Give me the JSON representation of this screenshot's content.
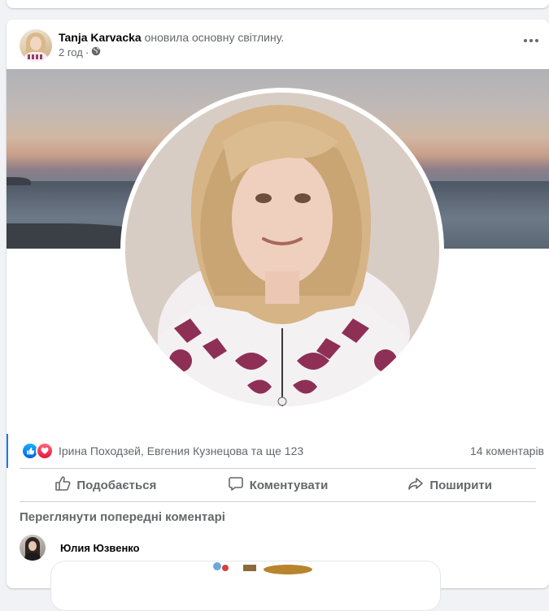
{
  "post": {
    "author_name": "Tanja Karvacka",
    "action_text": "оновила основну світлину.",
    "time_ago": "2 год",
    "privacy_icon": "globe-icon",
    "more_icon": "more-options-icon"
  },
  "reactions": {
    "icons": [
      "like-icon",
      "love-icon"
    ],
    "names_text": "Ірина Походзей, Евгения Кузнецова та ще 123",
    "comment_count_text": "14 коментарів"
  },
  "actions": {
    "like_label": "Подобається",
    "comment_label": "Коментувати",
    "share_label": "Поширити"
  },
  "comments": {
    "view_previous_label": "Переглянути попередні коментарі",
    "first_commenter_name": "Юлия Юзвенко"
  },
  "colors": {
    "accent": "#1877f2",
    "secondary_text": "#65676b",
    "like_blue": "#0062df",
    "love_red": "#e61739"
  }
}
